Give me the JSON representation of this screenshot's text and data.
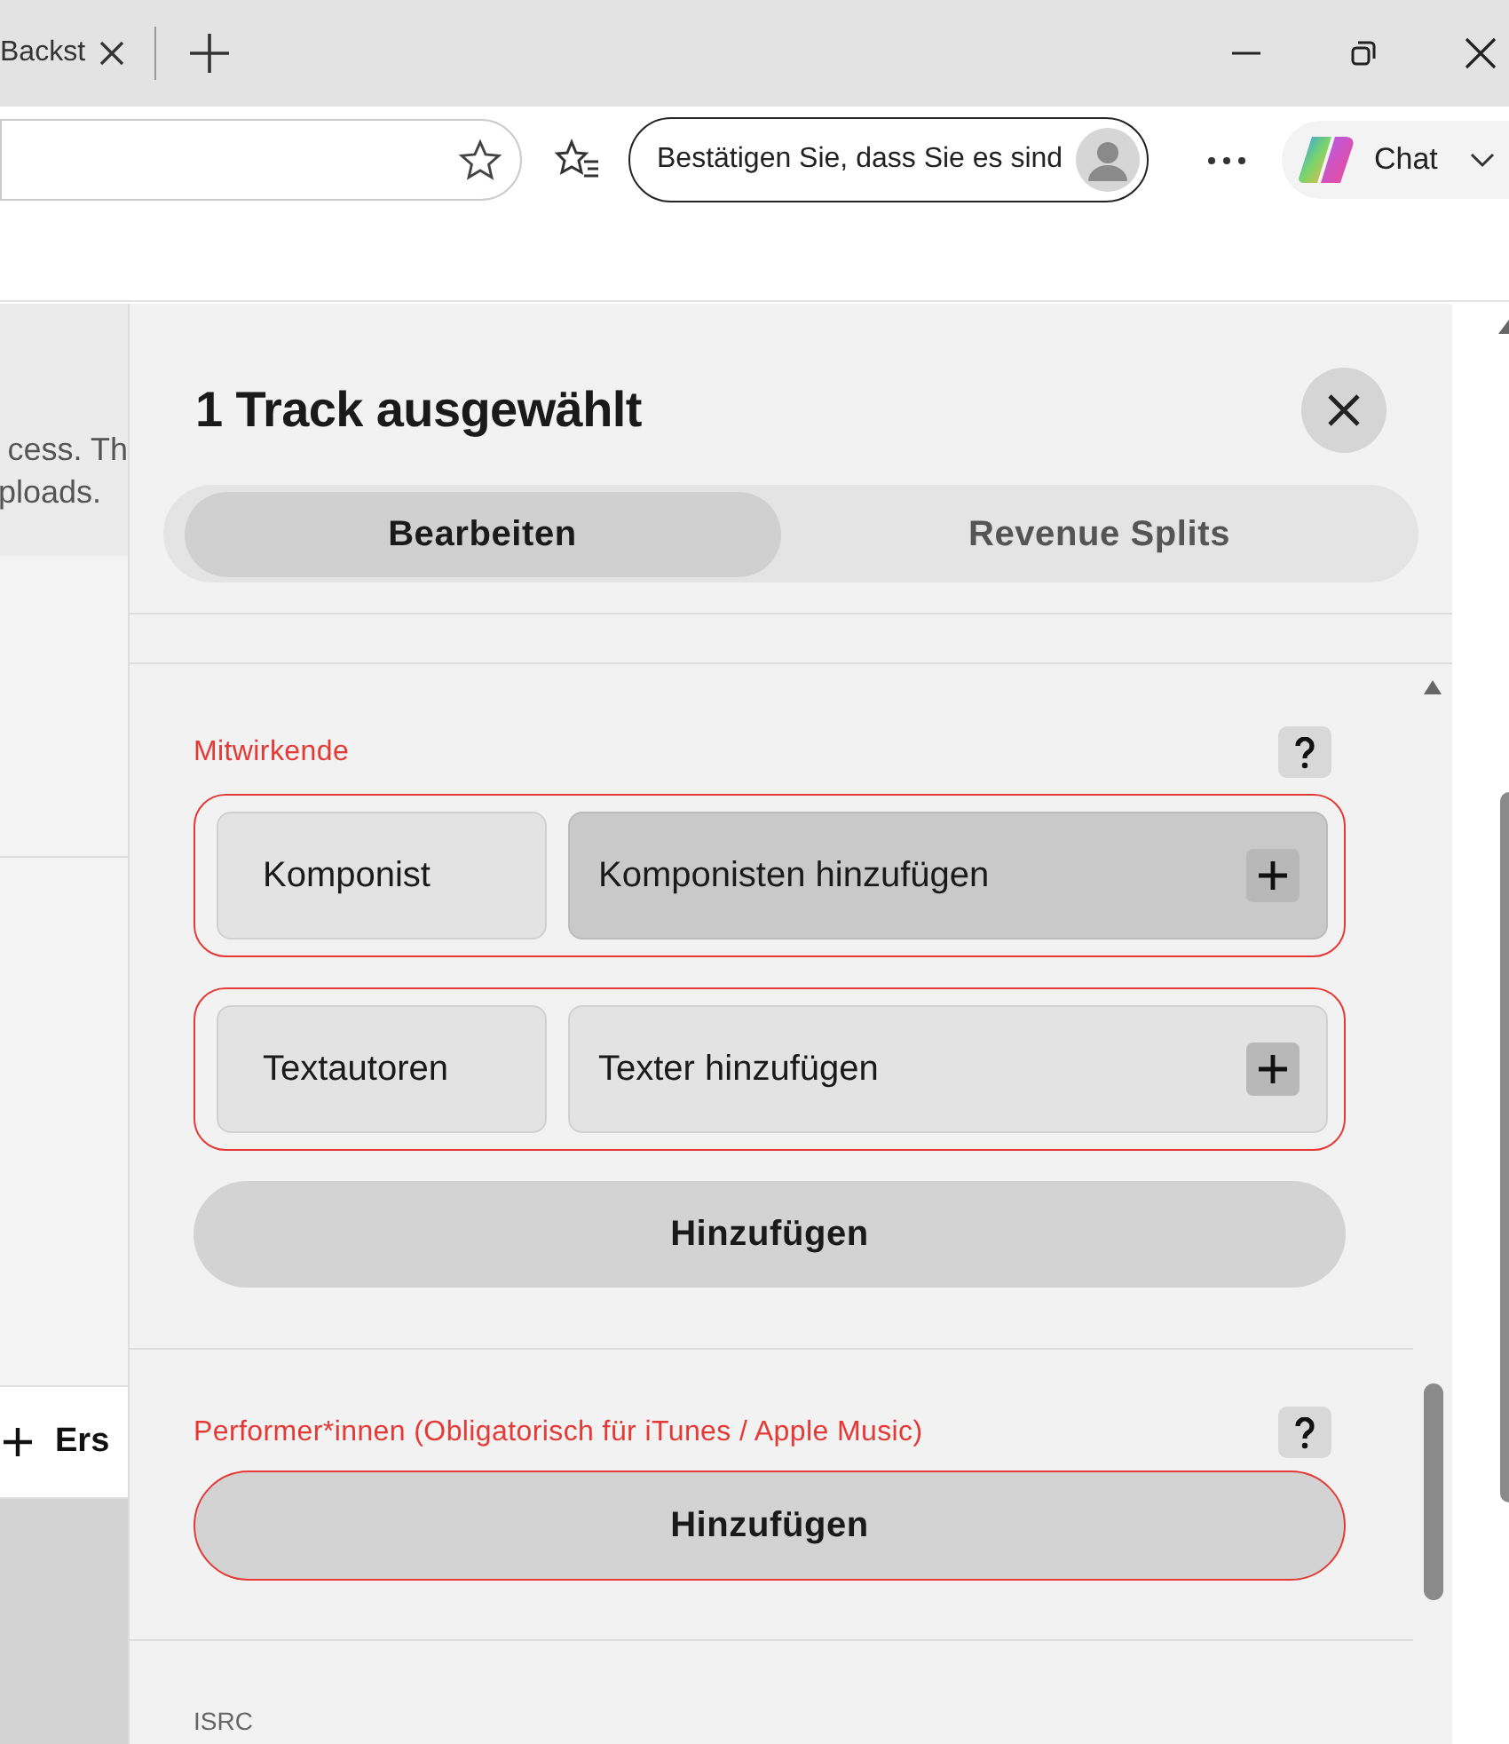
{
  "browser": {
    "tab": {
      "title": "Backst"
    },
    "profile_button": {
      "label": "Bestätigen Sie, dass Sie es sind"
    },
    "chat_button": {
      "label": "Chat"
    }
  },
  "background_page": {
    "text_lines": [
      "cess. Th",
      "ploads."
    ],
    "button": {
      "label": "Ers"
    }
  },
  "panel": {
    "title": "1 Track ausgewählt",
    "tabs": [
      {
        "label": "Bearbeiten",
        "selected": true
      },
      {
        "label": "Revenue Splits",
        "selected": false
      }
    ],
    "sections": [
      {
        "label": "Mitwirkende",
        "rows": [
          {
            "role": "Komponist",
            "action": "Komponisten hinzufügen",
            "highlighted": true
          },
          {
            "role": "Textautoren",
            "action": "Texter hinzufügen",
            "highlighted": false
          }
        ],
        "add_button": "Hinzufügen",
        "error": false
      },
      {
        "label": "Performer*innen (Obligatorisch für iTunes / Apple Music)",
        "add_button": "Hinzufügen",
        "error": true
      }
    ],
    "next_section_label": "ISRC"
  }
}
